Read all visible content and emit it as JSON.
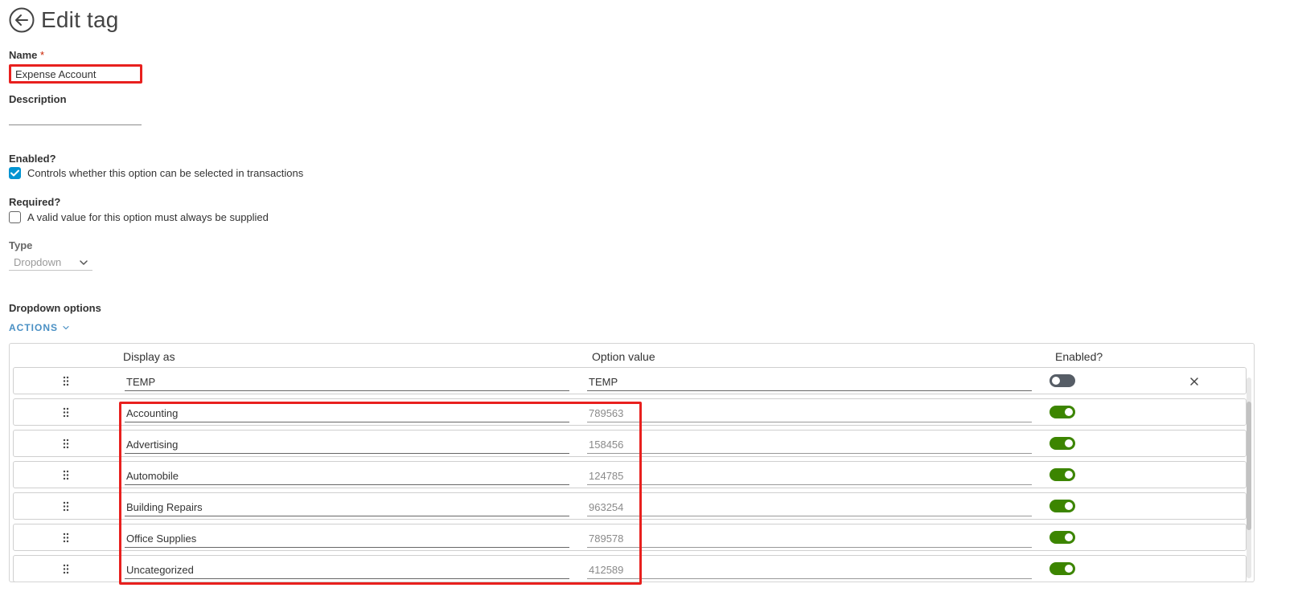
{
  "header": {
    "title": "Edit tag"
  },
  "name": {
    "label": "Name",
    "required_mark": "*",
    "value": "Expense Account"
  },
  "description": {
    "label": "Description",
    "value": ""
  },
  "enabled": {
    "label": "Enabled?",
    "checked": true,
    "text": "Controls whether this option can be selected in transactions"
  },
  "required": {
    "label": "Required?",
    "checked": false,
    "text": "A valid value for this option must always be supplied"
  },
  "type": {
    "label": "Type",
    "selected": "Dropdown"
  },
  "dropdown_options": {
    "label": "Dropdown options",
    "actions_label": "ACTIONS",
    "columns": {
      "display": "Display as",
      "value": "Option value",
      "enabled": "Enabled?"
    },
    "rows": [
      {
        "display": "TEMP",
        "value": "TEMP",
        "enabled": false
      },
      {
        "display": "Accounting",
        "value": "789563",
        "enabled": true
      },
      {
        "display": "Advertising",
        "value": "158456",
        "enabled": true
      },
      {
        "display": "Automobile",
        "value": "124785",
        "enabled": true
      },
      {
        "display": "Building Repairs",
        "value": "963254",
        "enabled": true
      },
      {
        "display": "Office Supplies",
        "value": "789578",
        "enabled": true
      },
      {
        "display": "Uncategorized",
        "value": "412589",
        "enabled": true
      }
    ]
  },
  "colors": {
    "accent": "#0094d2",
    "toggle_on": "#3c8500",
    "toggle_off": "#565d66",
    "highlight": "#e8201e"
  }
}
